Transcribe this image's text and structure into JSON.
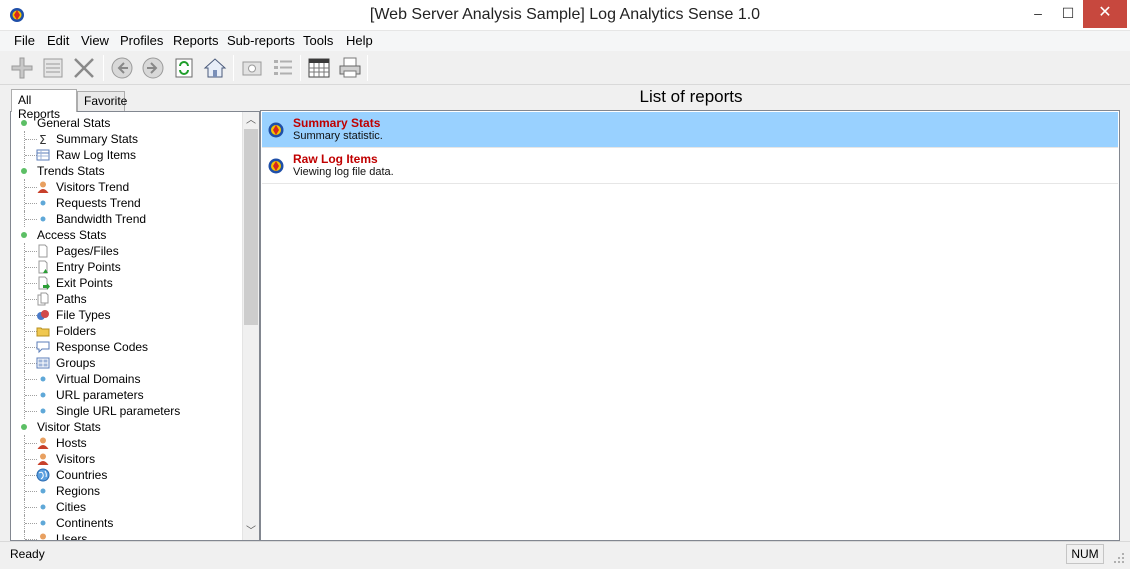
{
  "window": {
    "title": "[Web Server Analysis Sample] Log Analytics Sense 1.0",
    "minimize_glyph": "–",
    "maximize_glyph": "☐",
    "close_glyph": "✕"
  },
  "menu": [
    "File",
    "Edit",
    "View",
    "Profiles",
    "Reports",
    "Sub-reports",
    "Tools",
    "Help"
  ],
  "toolbar": {
    "icons": [
      "add-icon",
      "properties-icon",
      "delete-icon",
      "back-icon",
      "forward-icon",
      "refresh-icon",
      "home-icon",
      "screenshot-icon",
      "list-icon",
      "calendar-icon",
      "print-icon"
    ]
  },
  "left_tabs": [
    "All Reports",
    "Favorite"
  ],
  "tree": [
    {
      "label": "General Stats",
      "level": 0,
      "icon": "group-dot"
    },
    {
      "label": "Summary Stats",
      "level": 1,
      "icon": "sigma-icon"
    },
    {
      "label": "Raw Log Items",
      "level": 1,
      "icon": "table-icon"
    },
    {
      "label": "Trends Stats",
      "level": 0,
      "icon": "group-dot"
    },
    {
      "label": "Visitors Trend",
      "level": 1,
      "icon": "user-icon"
    },
    {
      "label": "Requests Trend",
      "level": 1,
      "icon": "bullet-icon"
    },
    {
      "label": "Bandwidth Trend",
      "level": 1,
      "icon": "bullet-icon"
    },
    {
      "label": "Access Stats",
      "level": 0,
      "icon": "group-dot"
    },
    {
      "label": "Pages/Files",
      "level": 1,
      "icon": "page-icon"
    },
    {
      "label": "Entry Points",
      "level": 1,
      "icon": "page-entry-icon"
    },
    {
      "label": "Exit Points",
      "level": 1,
      "icon": "page-exit-icon"
    },
    {
      "label": "Paths",
      "level": 1,
      "icon": "pages-icon"
    },
    {
      "label": "File Types",
      "level": 1,
      "icon": "filetypes-icon"
    },
    {
      "label": "Folders",
      "level": 1,
      "icon": "folder-icon"
    },
    {
      "label": "Response Codes",
      "level": 1,
      "icon": "speech-bubble-icon"
    },
    {
      "label": "Groups",
      "level": 1,
      "icon": "groups-icon"
    },
    {
      "label": "Virtual Domains",
      "level": 1,
      "icon": "bullet-icon"
    },
    {
      "label": "URL parameters",
      "level": 1,
      "icon": "bullet-icon"
    },
    {
      "label": "Single URL parameters",
      "level": 1,
      "icon": "bullet-icon"
    },
    {
      "label": "Visitor Stats",
      "level": 0,
      "icon": "group-dot"
    },
    {
      "label": "Hosts",
      "level": 1,
      "icon": "user-icon"
    },
    {
      "label": "Visitors",
      "level": 1,
      "icon": "user-icon"
    },
    {
      "label": "Countries",
      "level": 1,
      "icon": "globe-icon"
    },
    {
      "label": "Regions",
      "level": 1,
      "icon": "bullet-icon"
    },
    {
      "label": "Cities",
      "level": 1,
      "icon": "bullet-icon"
    },
    {
      "label": "Continents",
      "level": 1,
      "icon": "bullet-icon"
    },
    {
      "label": "Users",
      "level": 1,
      "icon": "user-icon"
    }
  ],
  "right_panel": {
    "header": "List of reports",
    "items": [
      {
        "title": "Summary Stats",
        "desc": "Summary statistic.",
        "selected": true
      },
      {
        "title": "Raw Log Items",
        "desc": "Viewing log file data.",
        "selected": false
      }
    ]
  },
  "status": {
    "text": "Ready",
    "num": "NUM"
  },
  "colors": {
    "selection": "#99d1ff",
    "report_title": "#c00000",
    "close_button": "#c7483e"
  }
}
